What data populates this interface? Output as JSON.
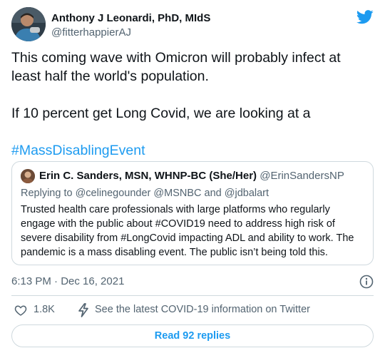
{
  "author": {
    "name": "Anthony J Leonardi, PhD, MIdS",
    "handle": "@fitterhappierAJ"
  },
  "tweet": {
    "line1": "This coming wave with Omicron will probably infect at",
    "line2": "least half the world's population.",
    "line3": "If 10 percent get Long Covid, we are looking at a",
    "hashtag": "#MassDisablingEvent"
  },
  "quote": {
    "name": "Erin C. Sanders, MSN, WHNP-BC (She/Her)",
    "handle": "@ErinSandersNP",
    "replying_to": "Replying to @celinegounder @MSNBC and @jdbalart",
    "body": [
      "Trusted health care professionals with large platforms who regularly",
      "engage with the public about #COVID19 need to address high risk of",
      "severe disability from #LongCovid impacting ADL and ability to work. The",
      "pandemic is a mass disabling event. The public isn’t being told this."
    ]
  },
  "timestamp": "6:13 PM · Dec 16, 2021",
  "actions": {
    "like_count": "1.8K",
    "covid_link": "See the latest COVID-19 information on Twitter"
  },
  "read_replies": "Read 92 replies",
  "colors": {
    "link": "#1d9bf0",
    "secondary_text": "#536471",
    "border": "#cfd9de"
  },
  "icons": [
    "twitter-bird-icon",
    "info-icon",
    "heart-icon",
    "lightning-icon"
  ]
}
